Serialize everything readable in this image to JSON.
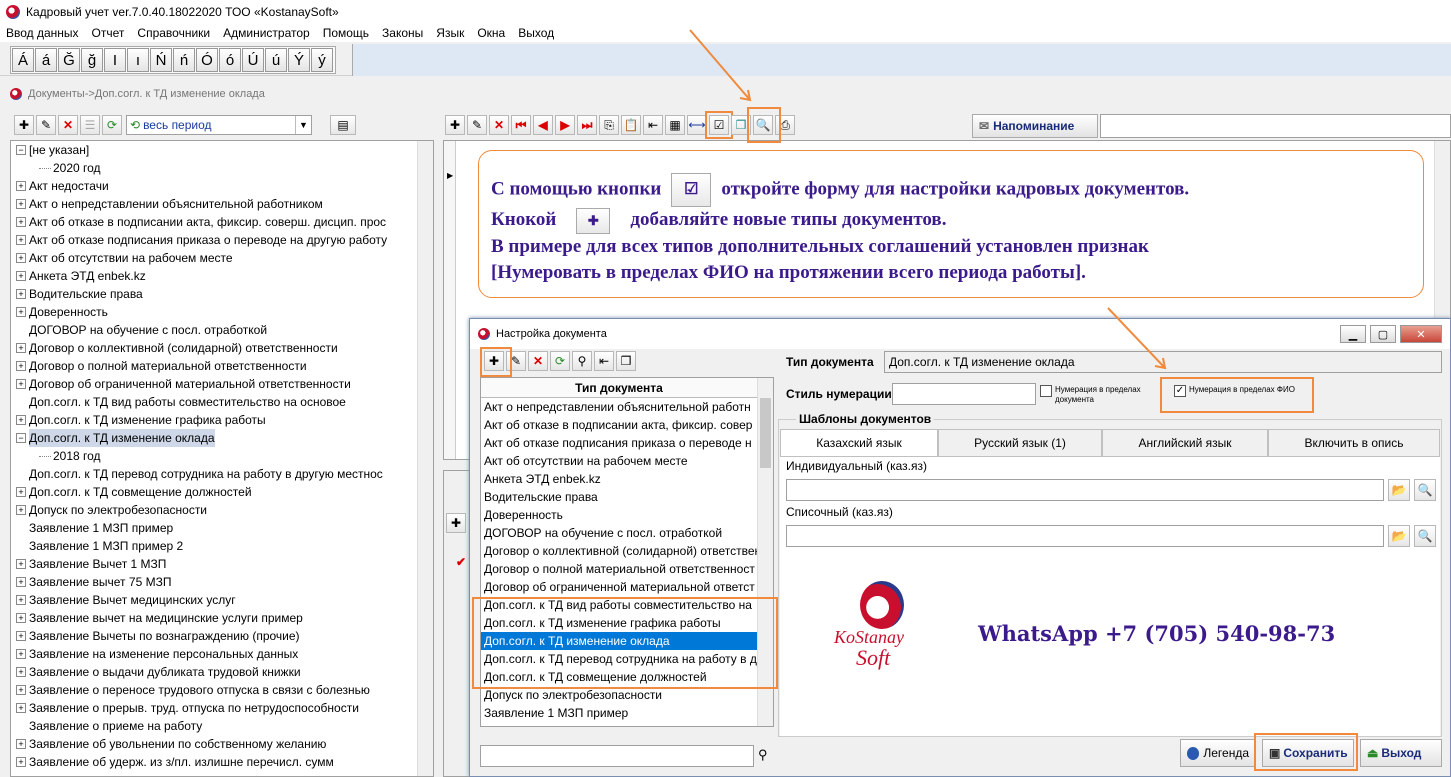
{
  "app": {
    "title": "Кадровый учет ver.7.0.40.18022020 ТОО «KostanaySoft»"
  },
  "menu": [
    "Ввод данных",
    "Отчет",
    "Справочники",
    "Администратор",
    "Помощь",
    "Законы",
    "Язык",
    "Окна",
    "Выход"
  ],
  "letters": [
    "Á",
    "á",
    "Ğ",
    "ğ",
    "I",
    "ı",
    "Ń",
    "ń",
    "Ó",
    "ó",
    "Ú",
    "ú",
    "Ý",
    "ý"
  ],
  "breadcrumb": "Документы->Доп.согл. к ТД изменение оклада",
  "period": "весь период",
  "reminder_label": "Напоминание",
  "tree": {
    "items": [
      {
        "label": "[не указан]",
        "state": "expanded"
      },
      {
        "label": "2020 год",
        "state": "child"
      },
      {
        "label": "Акт недостачи",
        "state": "collapsed"
      },
      {
        "label": "Акт о непредставлении объяснительной работником",
        "state": "collapsed"
      },
      {
        "label": "Акт об отказе в подписании акта, фиксир. соверш. дисцип. прос",
        "state": "collapsed"
      },
      {
        "label": "Акт об отказе подписания приказа о переводе на другую работу",
        "state": "collapsed"
      },
      {
        "label": "Акт об отсутствии на рабочем месте",
        "state": "collapsed"
      },
      {
        "label": "Анкета ЭТД enbek.kz",
        "state": "collapsed"
      },
      {
        "label": "Водительские права",
        "state": "collapsed"
      },
      {
        "label": "Доверенность",
        "state": "collapsed"
      },
      {
        "label": "ДОГОВОР на обучение с посл. отработкой",
        "state": "leaf"
      },
      {
        "label": "Договор о коллективной (солидарной) ответственности",
        "state": "collapsed"
      },
      {
        "label": "Договор о полной материальной ответственности",
        "state": "collapsed"
      },
      {
        "label": "Договор об ограниченной материальной ответственности",
        "state": "collapsed"
      },
      {
        "label": "Доп.согл. к ТД вид работы совместительство на основое",
        "state": "leaf"
      },
      {
        "label": "Доп.согл. к ТД изменение графика работы",
        "state": "collapsed"
      },
      {
        "label": "Доп.согл. к ТД изменение оклада",
        "state": "expanded-selected"
      },
      {
        "label": "2018 год",
        "state": "child"
      },
      {
        "label": "Доп.согл. к ТД перевод сотрудника на работу в другую местнос",
        "state": "leaf"
      },
      {
        "label": "Доп.согл. к ТД совмещение должностей",
        "state": "collapsed"
      },
      {
        "label": "Допуск по электробезопасности",
        "state": "collapsed"
      },
      {
        "label": "Заявление 1 МЗП пример",
        "state": "leaf"
      },
      {
        "label": "Заявление 1 МЗП пример 2",
        "state": "leaf"
      },
      {
        "label": "Заявление Вычет 1 МЗП",
        "state": "collapsed"
      },
      {
        "label": "Заявление вычет 75 МЗП",
        "state": "collapsed"
      },
      {
        "label": "Заявление Вычет медицинских услуг",
        "state": "collapsed"
      },
      {
        "label": "Заявление вычет на медицинские услуги пример",
        "state": "collapsed"
      },
      {
        "label": "Заявление Вычеты по вознаграждению (прочие)",
        "state": "collapsed"
      },
      {
        "label": "Заявление на изменение персональных данных",
        "state": "collapsed"
      },
      {
        "label": "Заявление о выдачи дубликата трудовой книжки",
        "state": "collapsed"
      },
      {
        "label": "Заявление о переносе трудового отпуска в связи с болезнью",
        "state": "collapsed"
      },
      {
        "label": "Заявление о прерыв. труд. отпуска по нетрудоспособности",
        "state": "collapsed"
      },
      {
        "label": "Заявление о приеме на работу",
        "state": "leaf"
      },
      {
        "label": "Заявление об увольнении по собственному желанию",
        "state": "collapsed"
      },
      {
        "label": "Заявление об удерж. из з/пл. излишне перечисл. сумм",
        "state": "collapsed"
      }
    ]
  },
  "hint": {
    "l1a": "С помощью кнопки",
    "l1b": "откройте форму для настройки кадровых документов.",
    "l2a": "Кнокой",
    "l2b": "добавляйте новые типы документов.",
    "l3": "В примере для всех типов дополнительных соглашений установлен признак",
    "l4": "[Нумеровать в пределах ФИО на протяжении всего периода работы]."
  },
  "dialog": {
    "title": "Настройка документа",
    "list_header": "Тип документа",
    "list": [
      "Акт о непредставлении объяснительной работн",
      "Акт об отказе в подписании акта, фиксир. совер",
      "Акт об отказе подписания приказа о переводе н",
      "Акт об отсутствии на рабочем месте",
      "Анкета ЭТД enbek.kz",
      "Водительские права",
      "Доверенность",
      "ДОГОВОР на обучение с посл. отработкой",
      "Договор о коллективной (солидарной) ответствен",
      "Договор о полной материальной ответственност",
      "Договор об ограниченной материальной ответст",
      "Доп.согл. к ТД вид работы совместительство на",
      "Доп.согл. к ТД изменение графика работы",
      "Доп.согл. к ТД изменение оклада",
      "Доп.согл. к ТД перевод сотрудника на работу в д",
      "Доп.согл. к ТД совмещение должностей",
      "Допуск по электробезопасности",
      "Заявление 1 МЗП пример"
    ],
    "selected_index": 13,
    "doc_type_label": "Тип документа",
    "doc_type_value": "Доп.согл. к ТД изменение оклада",
    "numbering_style_label": "Стиль нумерации",
    "numbering_style_value": "",
    "num_doc_label": "Нумерация в пределах документа",
    "num_doc_checked": false,
    "num_fio_label": "Нумерация в пределах ФИО",
    "num_fio_checked": true,
    "templates_label": "Шаблоны документов",
    "tabs": [
      "Казахский язык",
      "Русский язык (1)",
      "Английский язык",
      "Включить в опись"
    ],
    "active_tab": 0,
    "individual_label": "Индивидуальный (каз.яз)",
    "individual_value": "",
    "list_label": "Списочный (каз.яз)",
    "list_value": "",
    "logo_line1": "KoStanay",
    "logo_line2": "Soft",
    "whatsapp": "WhatsApp +7 (705) 540-98-73",
    "legend_label": "Легенда",
    "save_label": "Сохранить",
    "exit_label": "Выход",
    "search_value": ""
  }
}
